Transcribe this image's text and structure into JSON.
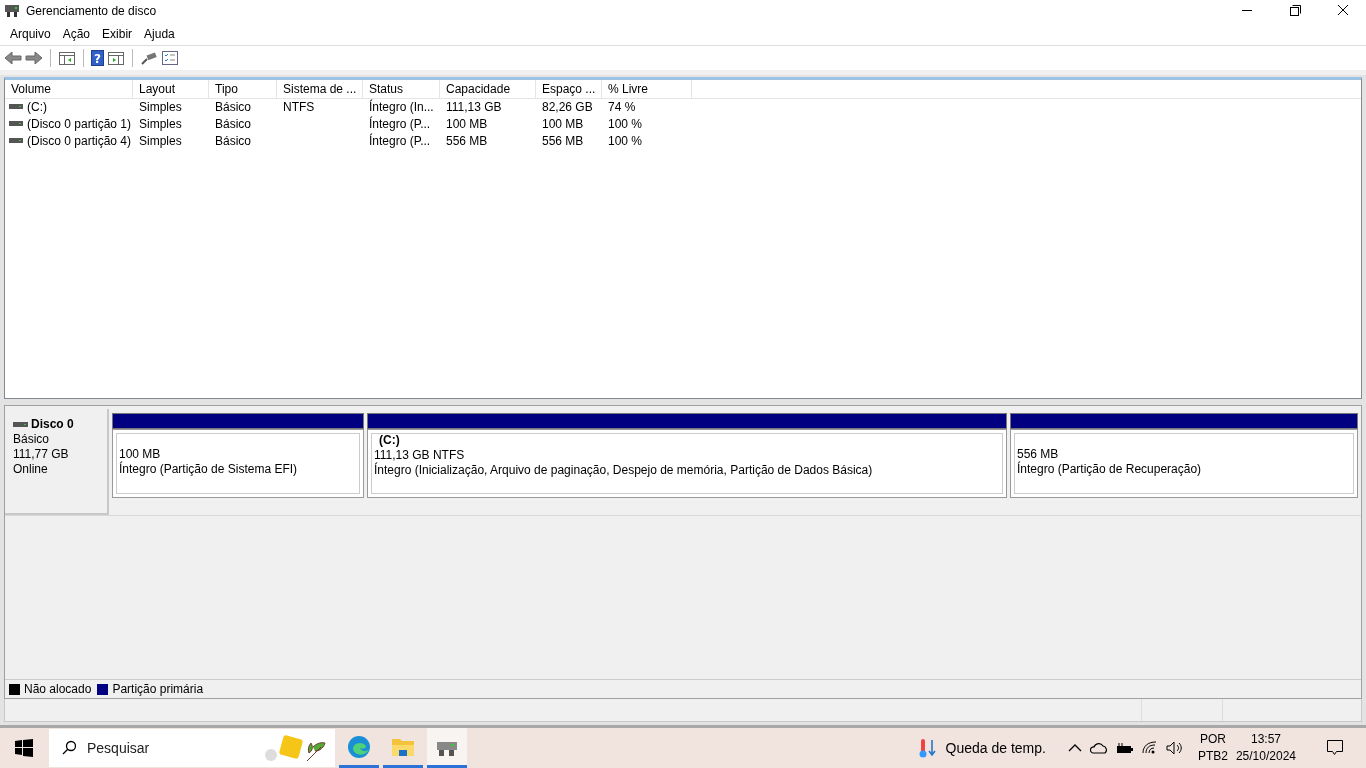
{
  "window": {
    "title": "Gerenciamento de disco"
  },
  "menu": [
    "Arquivo",
    "Ação",
    "Exibir",
    "Ajuda"
  ],
  "toolbar": {
    "help_glyph": "?"
  },
  "volumes": {
    "columns": [
      "Volume",
      "Layout",
      "Tipo",
      "Sistema de ...",
      "Status",
      "Capacidade",
      "Espaço ...",
      "% Livre"
    ],
    "rows": [
      [
        "(C:)",
        "Simples",
        "Básico",
        "NTFS",
        "Íntegro (In...",
        "111,13 GB",
        "82,26 GB",
        "74 %"
      ],
      [
        "(Disco 0 partição 1)",
        "Simples",
        "Básico",
        "",
        "Íntegro (P...",
        "100 MB",
        "100 MB",
        "100 %"
      ],
      [
        "(Disco 0 partição 4)",
        "Simples",
        "Básico",
        "",
        "Íntegro (P...",
        "556 MB",
        "556 MB",
        "100 %"
      ]
    ]
  },
  "disk": {
    "name": "Disco 0",
    "type": "Básico",
    "size": "111,77 GB",
    "state": "Online",
    "partitions": [
      {
        "size": "100 MB",
        "status": "Íntegro (Partição de Sistema EFI)"
      },
      {
        "label": "(C:)",
        "size": "111,13 GB NTFS",
        "status": "Íntegro (Inicialização, Arquivo de paginação, Despejo de memória, Partição de Dados Básica)"
      },
      {
        "size": "556 MB",
        "status": "Íntegro (Partição de Recuperação)"
      }
    ]
  },
  "legend": [
    {
      "label": "Não alocado",
      "color": "#000000"
    },
    {
      "label": "Partição primária",
      "color": "#000080"
    }
  ],
  "taskbar": {
    "search_placeholder": "Pesquisar",
    "apps": [
      {
        "kind": "browser",
        "selected": false
      },
      {
        "kind": "folder",
        "selected": false
      },
      {
        "kind": "disk",
        "selected": true
      }
    ],
    "weather": "Queda de temp.",
    "language": "POR",
    "layout": "PTB2",
    "time": "13:57",
    "date": "25/10/2024"
  }
}
